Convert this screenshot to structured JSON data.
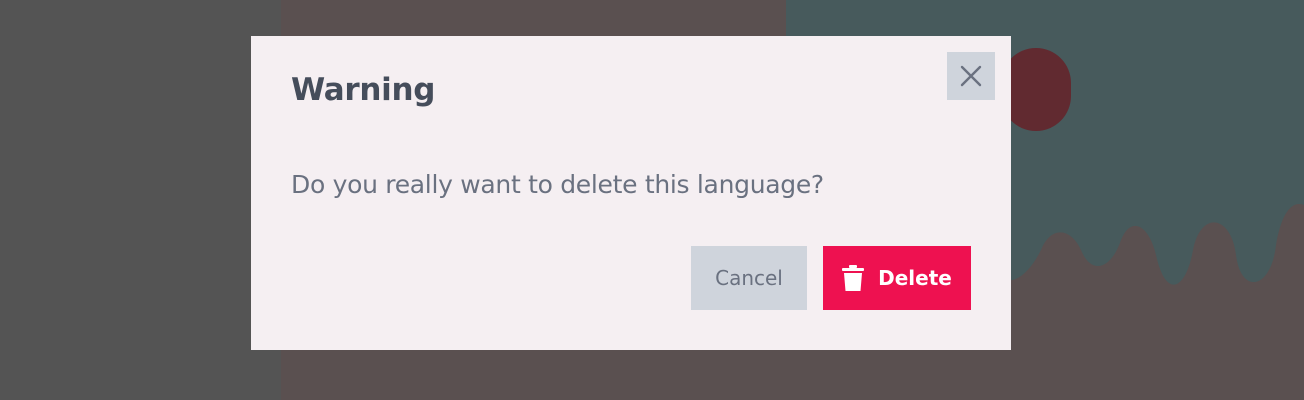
{
  "dialog": {
    "title": "Warning",
    "message": "Do you really want to delete this language?",
    "cancel_label": "Cancel",
    "delete_label": "Delete",
    "close_icon": "close-icon",
    "delete_icon": "trash-icon"
  },
  "colors": {
    "delete_accent": "#ee1150",
    "neutral_button": "#cfd4dc",
    "dialog_background": "#f5eff2",
    "title_text": "#454d5b",
    "body_text": "#6a7180"
  }
}
